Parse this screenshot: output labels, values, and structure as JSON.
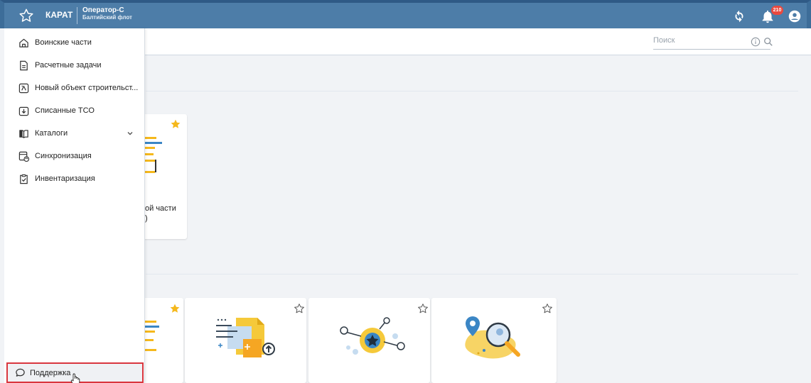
{
  "header": {
    "brand": "КАРАТ",
    "role": "Оператор-С",
    "org": "Балтийский флот",
    "notifications_count": "210",
    "icons": [
      "star-icon",
      "sync-icon",
      "bell-icon",
      "account-icon"
    ]
  },
  "search": {
    "placeholder": "Поиск"
  },
  "sidebar": {
    "items": [
      {
        "label": "Воинские части",
        "icon": "home-icon"
      },
      {
        "label": "Расчетные задачи",
        "icon": "document-icon"
      },
      {
        "label": "Новый объект строительст...",
        "icon": "construction-icon"
      },
      {
        "label": "Списанные ТСО",
        "icon": "download-box-icon"
      },
      {
        "label": "Каталоги",
        "icon": "book-icon"
      },
      {
        "label": "Синхронизация",
        "icon": "sync-doc-icon"
      },
      {
        "label": "Инвентаризация",
        "icon": "clipboard-icon"
      }
    ],
    "support_label": "Поддержка"
  },
  "cards": {
    "top_card_text_line1": "ой части",
    "top_card_text_line2": ")"
  },
  "colors": {
    "header_bg": "#4d7da8",
    "badge": "#e9493f",
    "favorite_star": "#f5b81c",
    "highlight_border": "#d9363e"
  }
}
